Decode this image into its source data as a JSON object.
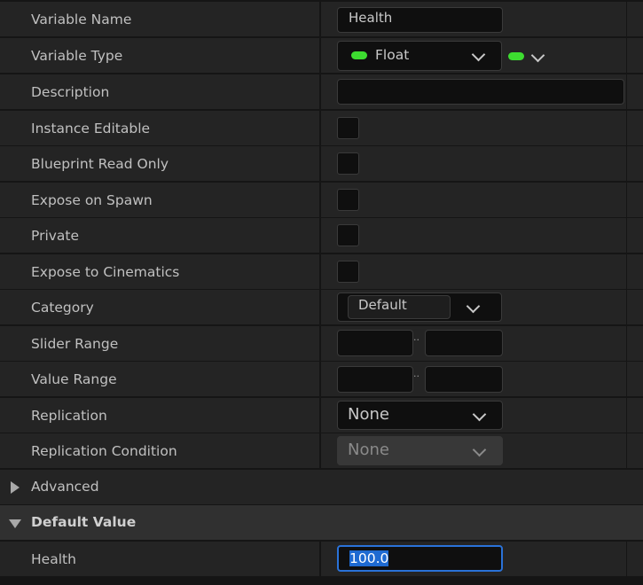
{
  "rows": {
    "variable_name": {
      "label": "Variable Name",
      "value": "Health"
    },
    "variable_type": {
      "label": "Variable Type",
      "value": "Float",
      "pill_color": "#3ddc30"
    },
    "description": {
      "label": "Description",
      "value": ""
    },
    "instance_editable": {
      "label": "Instance Editable",
      "checked": false
    },
    "blueprint_read_only": {
      "label": "Blueprint Read Only",
      "checked": false
    },
    "expose_on_spawn": {
      "label": "Expose on Spawn",
      "checked": false
    },
    "private": {
      "label": "Private",
      "checked": false
    },
    "expose_to_cinematics": {
      "label": "Expose to Cinematics",
      "checked": false
    },
    "category": {
      "label": "Category",
      "value": "Default"
    },
    "slider_range": {
      "label": "Slider Range",
      "separator": "..",
      "min": "",
      "max": ""
    },
    "value_range": {
      "label": "Value Range",
      "separator": "..",
      "min": "",
      "max": ""
    },
    "replication": {
      "label": "Replication",
      "value": "None"
    },
    "replication_condition": {
      "label": "Replication Condition",
      "value": "None",
      "disabled": true
    }
  },
  "sections": {
    "advanced": {
      "label": "Advanced",
      "expanded": false
    },
    "default_value": {
      "label": "Default Value",
      "expanded": true
    }
  },
  "default_value": {
    "label": "Health",
    "value": "100.0"
  },
  "colors": {
    "background": "#151515",
    "row": "#242424",
    "header": "#303030",
    "field": "#0f0f0f",
    "accent_focus": "#2a72d8",
    "float_pin": "#3ddc30"
  }
}
